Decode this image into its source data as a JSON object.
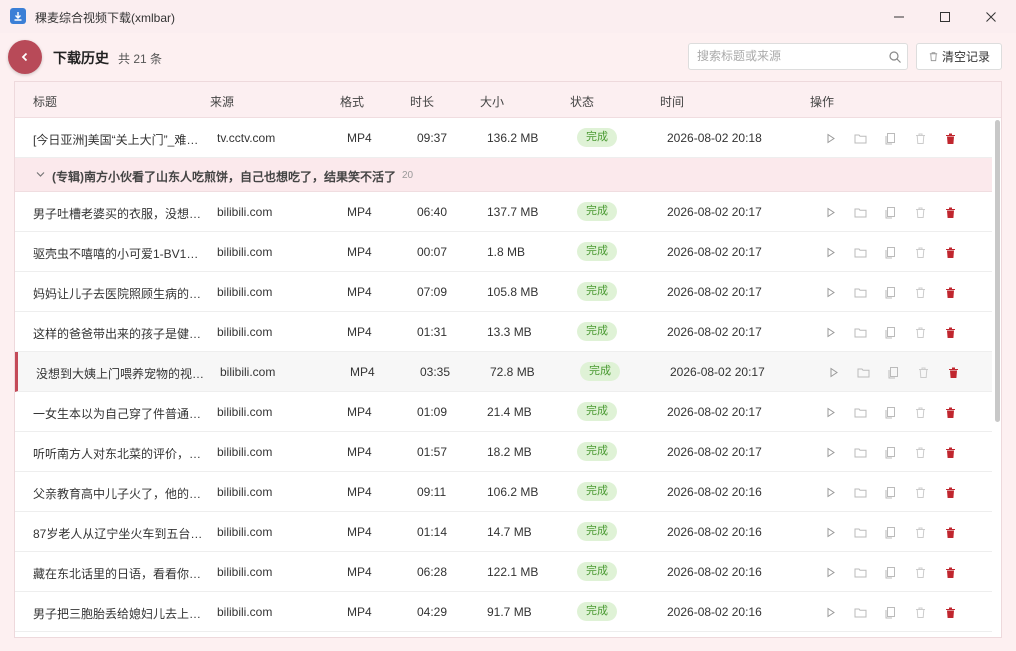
{
  "window": {
    "title": "稞麦综合视频下载(xmlbar)"
  },
  "header": {
    "title": "下载历史",
    "count": "共 21 条",
    "search_placeholder": "搜索标题或来源",
    "clear_label": "清空记录"
  },
  "columns": {
    "title": "标题",
    "source": "来源",
    "format": "格式",
    "duration": "时长",
    "size": "大小",
    "status": "状态",
    "time": "时间",
    "actions": "操作"
  },
  "first_row": {
    "title": "[今日亚洲]美国“关上大门”_难…",
    "source": "tv.cctv.com",
    "format": "MP4",
    "duration": "09:37",
    "size": "136.2 MB",
    "status": "完成",
    "time": "2026-08-02 20:18"
  },
  "group": {
    "title": "(专辑)南方小伙看了山东人吃煎饼，自己也想吃了，结果笑不活了",
    "count": "20"
  },
  "rows": [
    {
      "title": "男子吐槽老婆买的衣服，没想…",
      "source": "bilibili.com",
      "format": "MP4",
      "duration": "06:40",
      "size": "137.7 MB",
      "status": "完成",
      "time": "2026-08-02 20:17"
    },
    {
      "title": "驱壳虫不嘻嘻的小可爱1-BV1…",
      "source": "bilibili.com",
      "format": "MP4",
      "duration": "00:07",
      "size": "1.8 MB",
      "status": "完成",
      "time": "2026-08-02 20:17"
    },
    {
      "title": "妈妈让儿子去医院照顾生病的…",
      "source": "bilibili.com",
      "format": "MP4",
      "duration": "07:09",
      "size": "105.8 MB",
      "status": "完成",
      "time": "2026-08-02 20:17"
    },
    {
      "title": "这样的爸爸带出来的孩子是健…",
      "source": "bilibili.com",
      "format": "MP4",
      "duration": "01:31",
      "size": "13.3 MB",
      "status": "完成",
      "time": "2026-08-02 20:17"
    },
    {
      "title": "没想到大姨上门喂养宠物的视…",
      "source": "bilibili.com",
      "format": "MP4",
      "duration": "03:35",
      "size": "72.8 MB",
      "status": "完成",
      "time": "2026-08-02 20:17"
    },
    {
      "title": "一女生本以为自己穿了件普通…",
      "source": "bilibili.com",
      "format": "MP4",
      "duration": "01:09",
      "size": "21.4 MB",
      "status": "完成",
      "time": "2026-08-02 20:17"
    },
    {
      "title": "听听南方人对东北菜的评价，…",
      "source": "bilibili.com",
      "format": "MP4",
      "duration": "01:57",
      "size": "18.2 MB",
      "status": "完成",
      "time": "2026-08-02 20:17"
    },
    {
      "title": "父亲教育高中儿子火了，他的…",
      "source": "bilibili.com",
      "format": "MP4",
      "duration": "09:11",
      "size": "106.2 MB",
      "status": "完成",
      "time": "2026-08-02 20:16"
    },
    {
      "title": "87岁老人从辽宁坐火车到五台…",
      "source": "bilibili.com",
      "format": "MP4",
      "duration": "01:14",
      "size": "14.7 MB",
      "status": "完成",
      "time": "2026-08-02 20:16"
    },
    {
      "title": "藏在东北话里的日语，看看你…",
      "source": "bilibili.com",
      "format": "MP4",
      "duration": "06:28",
      "size": "122.1 MB",
      "status": "完成",
      "time": "2026-08-02 20:16"
    },
    {
      "title": "男子把三胞胎丢给媳妇儿去上…",
      "source": "bilibili.com",
      "format": "MP4",
      "duration": "04:29",
      "size": "91.7 MB",
      "status": "完成",
      "time": "2026-08-02 20:16"
    }
  ],
  "colors": {
    "accent": "#b84a58",
    "status_bg": "#dff2d6",
    "status_text": "#4a9a32",
    "delete_red": "#c0262e"
  }
}
